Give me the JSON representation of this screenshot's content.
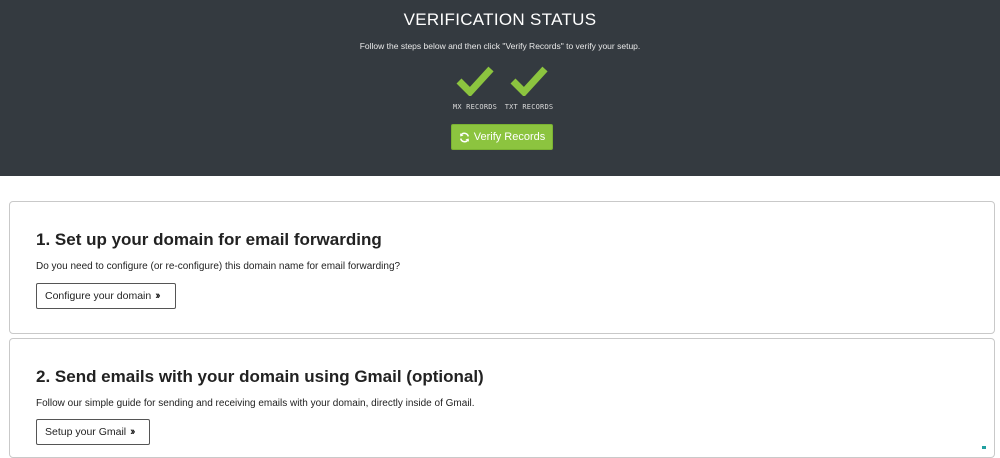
{
  "header": {
    "title": "VERIFICATION STATUS",
    "subtitle": "Follow the steps below and then click \"Verify Records\" to verify your setup.",
    "records": [
      {
        "label": "MX RECORDS",
        "icon": "check-icon",
        "status_color": "#8cc43f"
      },
      {
        "label": "TXT RECORDS",
        "icon": "check-icon",
        "status_color": "#8cc43f"
      }
    ],
    "verify_button": {
      "label": "Verify Records",
      "icon": "refresh-icon",
      "color": "#8cc43f"
    },
    "background": "#343a40"
  },
  "steps": [
    {
      "title": "1. Set up your domain for email forwarding",
      "description": "Do you need to configure (or re-configure) this domain name for email forwarding?",
      "button_label": "Configure your domain",
      "button_icon": "double-chevron-right-icon"
    },
    {
      "title": "2. Send emails with your domain using Gmail (optional)",
      "description": "Follow our simple guide for sending and receiving emails with your domain, directly inside of Gmail.",
      "button_label": "Setup your Gmail",
      "button_icon": "double-chevron-right-icon"
    }
  ]
}
